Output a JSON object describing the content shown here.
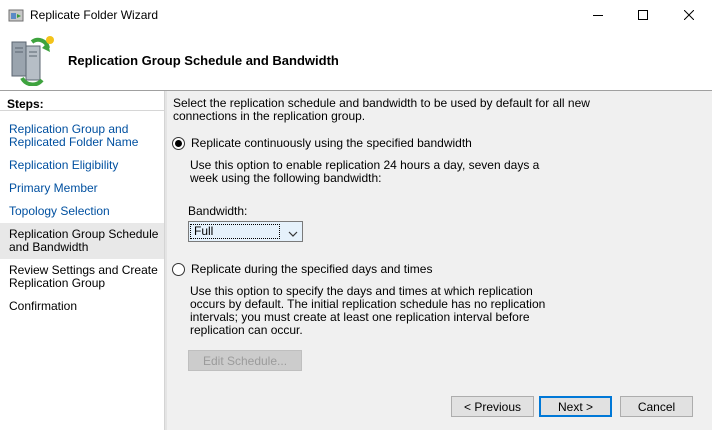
{
  "window": {
    "title": "Replicate Folder Wizard"
  },
  "header": {
    "title": "Replication Group Schedule and Bandwidth"
  },
  "sidebar": {
    "heading": "Steps:",
    "steps": [
      {
        "label": "Replication Group and Replicated Folder Name",
        "state": "link"
      },
      {
        "label": "Replication Eligibility",
        "state": "link"
      },
      {
        "label": "Primary Member",
        "state": "link"
      },
      {
        "label": "Topology Selection",
        "state": "link"
      },
      {
        "label": "Replication Group Schedule and Bandwidth",
        "state": "current"
      },
      {
        "label": "Review Settings and Create Replication Group",
        "state": "pending"
      },
      {
        "label": "Confirmation",
        "state": "pending"
      }
    ]
  },
  "main": {
    "intro": "Select the replication schedule and bandwidth to be used by default for all new connections in the replication group.",
    "option_continuous": {
      "label": "Replicate continuously using the specified bandwidth",
      "description": "Use this option to enable replication 24 hours a day, seven days a week using the following bandwidth:",
      "selected": true
    },
    "bandwidth": {
      "label": "Bandwidth:",
      "value": "Full"
    },
    "option_scheduled": {
      "label": "Replicate during the specified days and times",
      "description": "Use this option to specify the days and times at which replication occurs by default. The initial replication schedule has no replication intervals; you must create at least one replication interval before replication can occur.",
      "selected": false
    },
    "edit_schedule_label": "Edit Schedule..."
  },
  "footer": {
    "previous_label": "< Previous",
    "next_label": "Next >",
    "cancel_label": "Cancel"
  },
  "colors": {
    "link": "#0050a0",
    "accent": "#0078d7",
    "content_bg": "#f0f0f0"
  }
}
